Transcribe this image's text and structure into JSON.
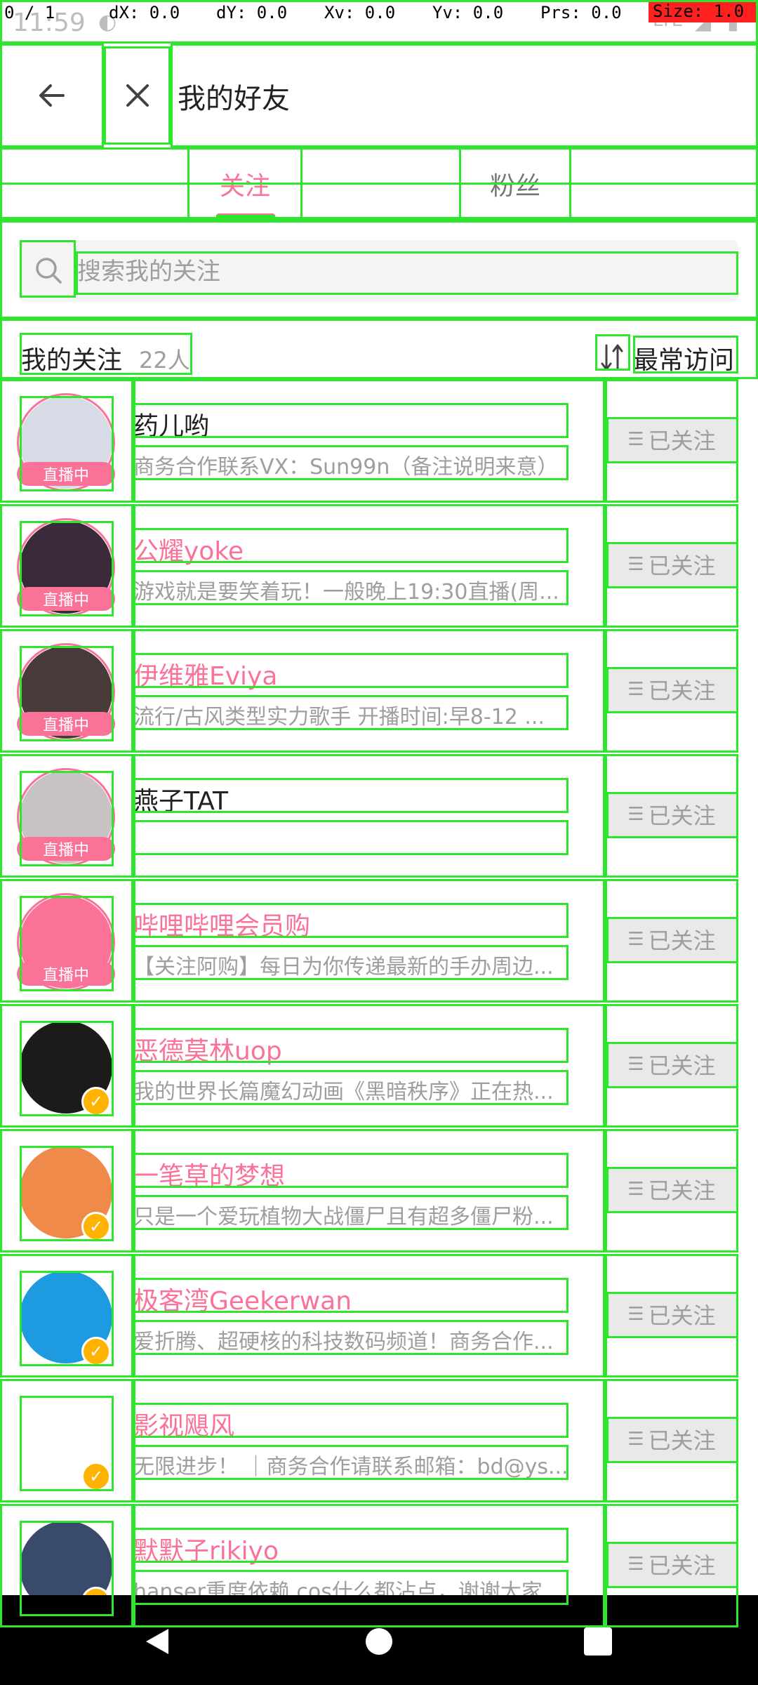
{
  "debug": {
    "pointer": "0 / 1",
    "dx": "dX: 0.0",
    "dy": "dY: 0.0",
    "xv": "Xv: 0.0",
    "yv": "Yv: 0.0",
    "prs": "Prs: 0.0",
    "size": "Size: 1.0"
  },
  "status": {
    "time": "11:59",
    "network": "LTE"
  },
  "header": {
    "title": "我的好友"
  },
  "tabs": [
    {
      "label": "关注",
      "active": true
    },
    {
      "label": "粉丝",
      "active": false
    }
  ],
  "search": {
    "placeholder": "搜索我的关注"
  },
  "section": {
    "title": "我的关注",
    "count": "22人",
    "sort_label": "最常访问"
  },
  "follow_label": "已关注",
  "live_label": "直播中",
  "users": [
    {
      "name": "药儿哟",
      "sign": "商务合作联系VX：Sun99n（备注说明来意）",
      "vip": false,
      "badge": "live",
      "avatar_color": "#d7dbe6"
    },
    {
      "name": "公耀yoke",
      "sign": "游戏就是要笑着玩！一般晚上19:30直播(周...",
      "vip": true,
      "badge": "live",
      "avatar_color": "#3b2a3a"
    },
    {
      "name": "伊维雅Eviya",
      "sign": "流行/古风类型实力歌手 开播时间:早8-12 ...",
      "vip": true,
      "badge": "live",
      "avatar_color": "#4a3a3a"
    },
    {
      "name": "燕子TAT",
      "sign": "",
      "vip": false,
      "badge": "live",
      "avatar_color": "#c9c2c4"
    },
    {
      "name": "哔哩哔哩会员购",
      "sign": "【关注阿购】每日为你传递最新的手办周边...",
      "vip": true,
      "badge": "live",
      "avatar_color": "#fb7299"
    },
    {
      "name": "恶德莫林uop",
      "sign": "我的世界长篇魔幻动画《黑暗秩序》正在热...",
      "vip": true,
      "badge": "verified",
      "avatar_color": "#1b1b1b"
    },
    {
      "name": "一笔草的梦想",
      "sign": "只是一个爱玩植物大战僵尸且有超多僵尸粉...",
      "vip": true,
      "badge": "verified",
      "avatar_color": "#f08a4b"
    },
    {
      "name": "极客湾Geekerwan",
      "sign": "爱折腾、超硬核的科技数码频道！商务合作...",
      "vip": true,
      "badge": "verified",
      "avatar_color": "#1e9be0"
    },
    {
      "name": "影视飓风",
      "sign": "无限进步！ ｜商务合作请联系邮箱：bd@ys...",
      "vip": true,
      "badge": "verified",
      "avatar_color": "#ffffff"
    },
    {
      "name": "默默子rikiyo",
      "sign": "hanser重度依赖 cos什么都沾点，谢谢大家...",
      "vip": true,
      "badge": "verified",
      "avatar_color": "#3a4a6a"
    }
  ]
}
